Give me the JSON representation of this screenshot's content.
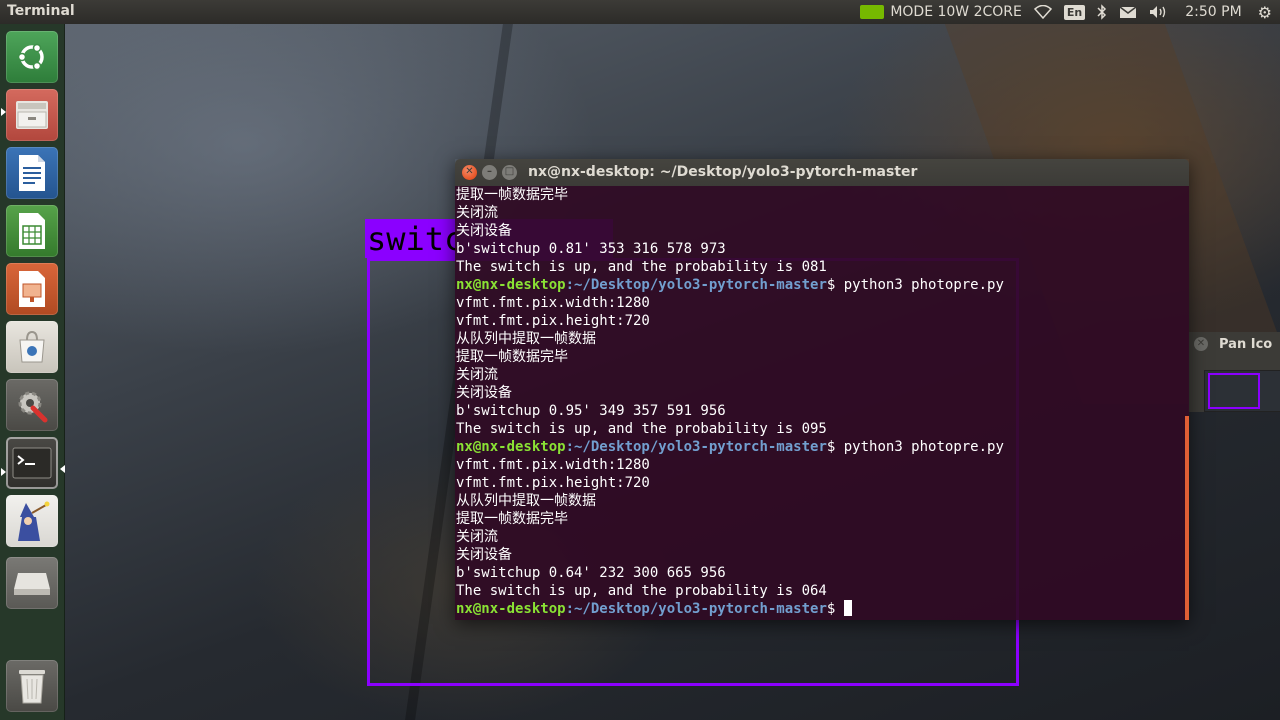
{
  "top_panel": {
    "app_title": "Terminal",
    "power_mode": "MODE 10W 2CORE",
    "keyboard_layout": "En",
    "clock": "2:50 PM",
    "icons": [
      "nvidia-icon",
      "wifi-icon",
      "keyboard-icon",
      "bluetooth-icon",
      "mail-icon",
      "volume-icon",
      "settings-gear-icon"
    ]
  },
  "launcher": {
    "items": [
      {
        "name": "ubuntu-dash",
        "icon": "ubuntu-logo-icon"
      },
      {
        "name": "files",
        "icon": "file-cabinet-icon"
      },
      {
        "name": "libreoffice-writer",
        "icon": "writer-document-icon"
      },
      {
        "name": "libreoffice-calc",
        "icon": "calc-spreadsheet-icon"
      },
      {
        "name": "libreoffice-impress",
        "icon": "impress-presentation-icon"
      },
      {
        "name": "software-center",
        "icon": "shopping-bag-icon"
      },
      {
        "name": "system-settings",
        "icon": "wrench-gear-icon"
      },
      {
        "name": "terminal",
        "icon": "terminal-icon"
      },
      {
        "name": "wizard-app",
        "icon": "wizard-icon"
      },
      {
        "name": "drive",
        "icon": "drive-icon"
      },
      {
        "name": "trash",
        "icon": "trash-icon"
      }
    ]
  },
  "detection_overlay": {
    "label": "switc",
    "color": "#8b00ff"
  },
  "side_window": {
    "title": "Pan Ico"
  },
  "terminal": {
    "title": "nx@nx-desktop: ~/Desktop/yolo3-pytorch-master",
    "prompt_user": "nx@nx-desktop",
    "prompt_path": ":~/Desktop/yolo3-pytorch-master",
    "prompt_symbol": "$",
    "lines": [
      {
        "type": "out",
        "text": "提取一帧数据完毕"
      },
      {
        "type": "out",
        "text": "关闭流"
      },
      {
        "type": "out",
        "text": "关闭设备"
      },
      {
        "type": "out",
        "text": "b'switchup 0.81' 353 316 578 973"
      },
      {
        "type": "out",
        "text": "The switch is up, and the probability is 081"
      },
      {
        "type": "cmd",
        "text": " python3 photopre.py"
      },
      {
        "type": "out",
        "text": "vfmt.fmt.pix.width:1280"
      },
      {
        "type": "out",
        "text": "vfmt.fmt.pix.height:720"
      },
      {
        "type": "out",
        "text": "从队列中提取一帧数据"
      },
      {
        "type": "out",
        "text": "提取一帧数据完毕"
      },
      {
        "type": "out",
        "text": "关闭流"
      },
      {
        "type": "out",
        "text": "关闭设备"
      },
      {
        "type": "out",
        "text": "b'switchup 0.95' 349 357 591 956"
      },
      {
        "type": "out",
        "text": "The switch is up, and the probability is 095"
      },
      {
        "type": "cmd",
        "text": " python3 photopre.py"
      },
      {
        "type": "out",
        "text": "vfmt.fmt.pix.width:1280"
      },
      {
        "type": "out",
        "text": "vfmt.fmt.pix.height:720"
      },
      {
        "type": "out",
        "text": "从队列中提取一帧数据"
      },
      {
        "type": "out",
        "text": "提取一帧数据完毕"
      },
      {
        "type": "out",
        "text": "关闭流"
      },
      {
        "type": "out",
        "text": "关闭设备"
      },
      {
        "type": "out",
        "text": "b'switchup 0.64' 232 300 665 956"
      },
      {
        "type": "out",
        "text": "The switch is up, and the probability is 064"
      },
      {
        "type": "cmd",
        "text": " ",
        "cursor": true
      }
    ],
    "colors": {
      "background": "#300a24",
      "prompt_user": "#8ae234",
      "prompt_path": "#729fcf",
      "text": "#ffffff"
    }
  }
}
